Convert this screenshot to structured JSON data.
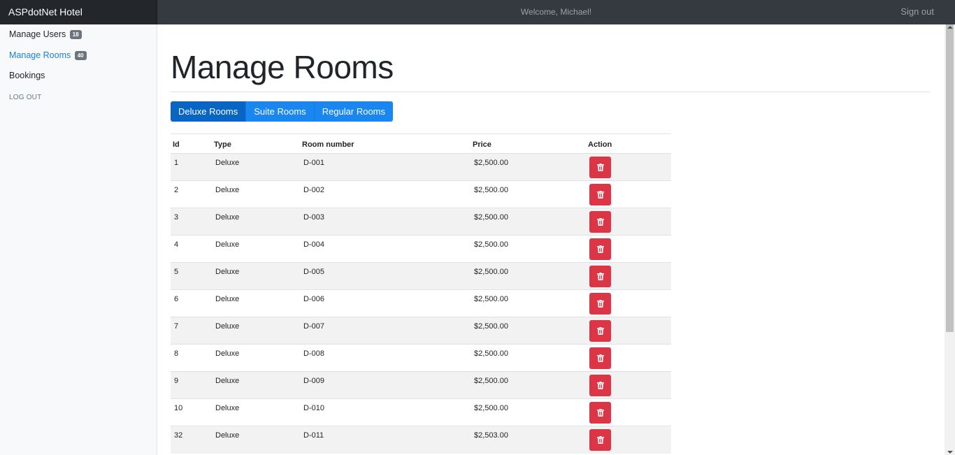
{
  "header": {
    "brand": "ASPdotNet Hotel",
    "welcome": "Welcome, Michael!",
    "signout": "Sign out"
  },
  "sidebar": {
    "items": [
      {
        "label": "Manage Users",
        "badge": "18",
        "active": false
      },
      {
        "label": "Manage Rooms",
        "badge": "40",
        "active": true
      },
      {
        "label": "Bookings",
        "badge": "",
        "active": false
      }
    ],
    "logout": "LOG OUT"
  },
  "main": {
    "title": "Manage Rooms",
    "tabs": [
      {
        "label": "Deluxe Rooms",
        "active": true
      },
      {
        "label": "Suite Rooms",
        "active": false
      },
      {
        "label": "Regular Rooms",
        "active": false
      }
    ],
    "table": {
      "columns": [
        "Id",
        "Type",
        "Room number",
        "Price",
        "Action"
      ],
      "rows": [
        {
          "id": "1",
          "type": "Deluxe",
          "room": "D-001",
          "price": "$2,500.00"
        },
        {
          "id": "2",
          "type": "Deluxe",
          "room": "D-002",
          "price": "$2,500.00"
        },
        {
          "id": "3",
          "type": "Deluxe",
          "room": "D-003",
          "price": "$2,500.00"
        },
        {
          "id": "4",
          "type": "Deluxe",
          "room": "D-004",
          "price": "$2,500.00"
        },
        {
          "id": "5",
          "type": "Deluxe",
          "room": "D-005",
          "price": "$2,500.00"
        },
        {
          "id": "6",
          "type": "Deluxe",
          "room": "D-006",
          "price": "$2,500.00"
        },
        {
          "id": "7",
          "type": "Deluxe",
          "room": "D-007",
          "price": "$2,500.00"
        },
        {
          "id": "8",
          "type": "Deluxe",
          "room": "D-008",
          "price": "$2,500.00"
        },
        {
          "id": "9",
          "type": "Deluxe",
          "room": "D-009",
          "price": "$2,500.00"
        },
        {
          "id": "10",
          "type": "Deluxe",
          "room": "D-010",
          "price": "$2,500.00"
        },
        {
          "id": "32",
          "type": "Deluxe",
          "room": "D-011",
          "price": "$2,503.00"
        }
      ],
      "row_action_icon": "trash-icon"
    }
  },
  "colors": {
    "topbar": "#343a40",
    "brand_bg": "#23272b",
    "primary": "#1a86f0",
    "primary_active": "#0965c4",
    "danger": "#dc3545",
    "badge": "#6c757d",
    "active_link": "#1a7fd8"
  }
}
